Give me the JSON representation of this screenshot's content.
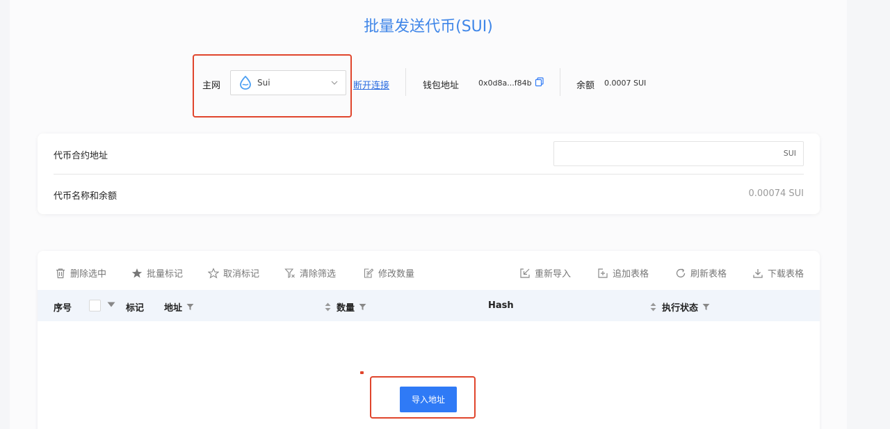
{
  "title": "批量发送代币(SUI)",
  "network": {
    "label": "主网",
    "selected": "Sui",
    "disconnect_label": "断开连接",
    "wallet_label": "钱包地址",
    "wallet_address": "0x0d8a...f84b",
    "balance_label": "余额",
    "balance_value": "0.0007 SUI"
  },
  "token": {
    "contract_label": "代币合约地址",
    "contract_value": "SUI",
    "name_balance_label": "代币名称和余额",
    "name_balance_value": "0.00074 SUI"
  },
  "toolbar": {
    "delete_selected": "删除选中",
    "batch_mark": "批量标记",
    "cancel_mark": "取消标记",
    "clear_filter": "清除筛选",
    "edit_amount": "修改数量",
    "reimport": "重新导入",
    "append_table": "追加表格",
    "refresh_table": "刷新表格",
    "download_table": "下载表格"
  },
  "table": {
    "columns": [
      "序号",
      "标记",
      "地址",
      "数量",
      "Hash",
      "执行状态"
    ]
  },
  "import_button": "导入地址",
  "colors": {
    "accent": "#2f7af6",
    "title": "#3f86e8",
    "highlight": "#e0452c"
  }
}
